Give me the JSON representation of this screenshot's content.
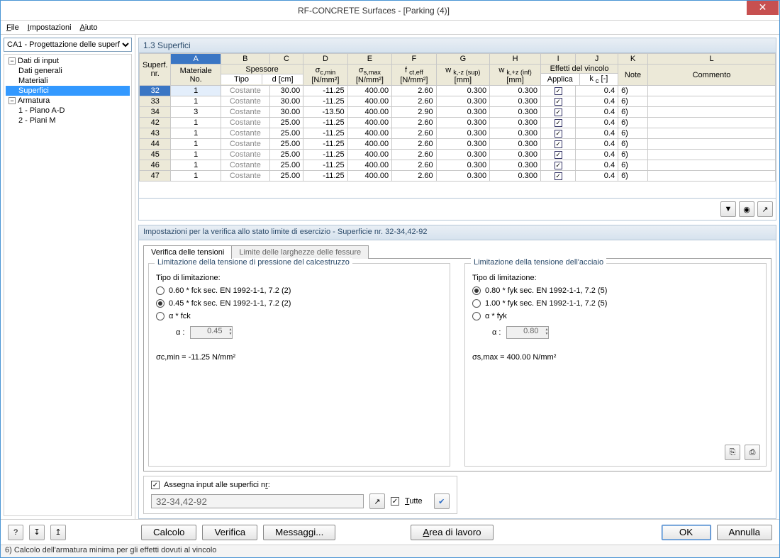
{
  "window": {
    "title": "RF-CONCRETE Surfaces - [Parking (4)]"
  },
  "menu": {
    "file": "File",
    "settings": "Impostazioni",
    "help": "Aiuto"
  },
  "combo": {
    "value": "CA1 - Progettazione delle superf"
  },
  "tree": {
    "root": "Dati di input",
    "n1": "Dati generali",
    "n2": "Materiali",
    "n3": "Superfici",
    "arm": "Armatura",
    "a1": "1 - Piano A-D",
    "a2": "2 - Piani M"
  },
  "panelTitle": "1.3 Superfici",
  "cols": {
    "letters": [
      "A",
      "B",
      "C",
      "D",
      "E",
      "F",
      "G",
      "H",
      "I",
      "J",
      "K",
      "L"
    ],
    "h_superf": "Superf.\nnr.",
    "h_mat": "Materiale\nNo.",
    "h_spess": "Spessore",
    "h_tipo": "Tipo",
    "h_d": "d [cm]",
    "h_scmin": "σc,min\n[N/mm²]",
    "h_ssmax": "σs,max\n[N/mm²]",
    "h_fct": "f ct,eff\n[N/mm²]",
    "h_wkz": "w k,-z (sup)\n[mm]",
    "h_wkz2": "w k,+z (inf)\n[mm]",
    "h_eff": "Effetti del vincolo",
    "h_appl": "Applica",
    "h_kc": "k c [-]",
    "h_note": "Note",
    "h_comm": "Commento"
  },
  "rows": [
    {
      "nr": "32",
      "mat": "1",
      "tipo": "Costante",
      "d": "30.00",
      "scmin": "-11.25",
      "ssmax": "400.00",
      "fct": "2.60",
      "wkz": "0.300",
      "wkz2": "0.300",
      "appl": true,
      "kc": "0.4",
      "note": "6)"
    },
    {
      "nr": "33",
      "mat": "1",
      "tipo": "Costante",
      "d": "30.00",
      "scmin": "-11.25",
      "ssmax": "400.00",
      "fct": "2.60",
      "wkz": "0.300",
      "wkz2": "0.300",
      "appl": true,
      "kc": "0.4",
      "note": "6)"
    },
    {
      "nr": "34",
      "mat": "3",
      "tipo": "Costante",
      "d": "30.00",
      "scmin": "-13.50",
      "ssmax": "400.00",
      "fct": "2.90",
      "wkz": "0.300",
      "wkz2": "0.300",
      "appl": true,
      "kc": "0.4",
      "note": "6)"
    },
    {
      "nr": "42",
      "mat": "1",
      "tipo": "Costante",
      "d": "25.00",
      "scmin": "-11.25",
      "ssmax": "400.00",
      "fct": "2.60",
      "wkz": "0.300",
      "wkz2": "0.300",
      "appl": true,
      "kc": "0.4",
      "note": "6)"
    },
    {
      "nr": "43",
      "mat": "1",
      "tipo": "Costante",
      "d": "25.00",
      "scmin": "-11.25",
      "ssmax": "400.00",
      "fct": "2.60",
      "wkz": "0.300",
      "wkz2": "0.300",
      "appl": true,
      "kc": "0.4",
      "note": "6)"
    },
    {
      "nr": "44",
      "mat": "1",
      "tipo": "Costante",
      "d": "25.00",
      "scmin": "-11.25",
      "ssmax": "400.00",
      "fct": "2.60",
      "wkz": "0.300",
      "wkz2": "0.300",
      "appl": true,
      "kc": "0.4",
      "note": "6)"
    },
    {
      "nr": "45",
      "mat": "1",
      "tipo": "Costante",
      "d": "25.00",
      "scmin": "-11.25",
      "ssmax": "400.00",
      "fct": "2.60",
      "wkz": "0.300",
      "wkz2": "0.300",
      "appl": true,
      "kc": "0.4",
      "note": "6)"
    },
    {
      "nr": "46",
      "mat": "1",
      "tipo": "Costante",
      "d": "25.00",
      "scmin": "-11.25",
      "ssmax": "400.00",
      "fct": "2.60",
      "wkz": "0.300",
      "wkz2": "0.300",
      "appl": true,
      "kc": "0.4",
      "note": "6)"
    },
    {
      "nr": "47",
      "mat": "1",
      "tipo": "Costante",
      "d": "25.00",
      "scmin": "-11.25",
      "ssmax": "400.00",
      "fct": "2.60",
      "wkz": "0.300",
      "wkz2": "0.300",
      "appl": true,
      "kc": "0.4",
      "note": "6)"
    }
  ],
  "settingsHeader": "Impostazioni per la verifica allo stato limite di esercizio - Superficie nr. 32-34,42-92",
  "tabs": {
    "t1": "Verifica delle tensioni",
    "t2": "Limite delle larghezze delle fessure"
  },
  "concrete": {
    "title": "Limitazione della tensione di pressione del calcestruzzo",
    "typeLabel": "Tipo di limitazione:",
    "r1": "0.60 * fck sec. EN 1992-1-1, 7.2 (2)",
    "r2": "0.45 * fck sec. EN 1992-1-1, 7.2 (2)",
    "r3": "α * fck",
    "alphaLabel": "α :",
    "alphaVal": "0.45",
    "result": "σc,min  =  -11.25 N/mm²"
  },
  "steel": {
    "title": "Limitazione della tensione dell'acciaio",
    "typeLabel": "Tipo di limitazione:",
    "r1": "0.80 * fyk sec. EN 1992-1-1, 7.2 (5)",
    "r2": "1.00 * fyk sec. EN 1992-1-1, 7.2 (5)",
    "r3": "α * fyk",
    "alphaLabel": "α :",
    "alphaVal": "0.80",
    "result": "σs,max =  400.00 N/mm²"
  },
  "assign": {
    "chkLabel": "Assegna input alle superfici nr:",
    "value": "32-34,42-92",
    "tutte": "Tutte"
  },
  "buttons": {
    "calcolo": "Calcolo",
    "verifica": "Verifica",
    "messaggi": "Messaggi...",
    "area": "Area di lavoro",
    "ok": "OK",
    "annulla": "Annulla"
  },
  "status": "6) Calcolo dell'armatura minima per gli effetti dovuti al vincolo"
}
